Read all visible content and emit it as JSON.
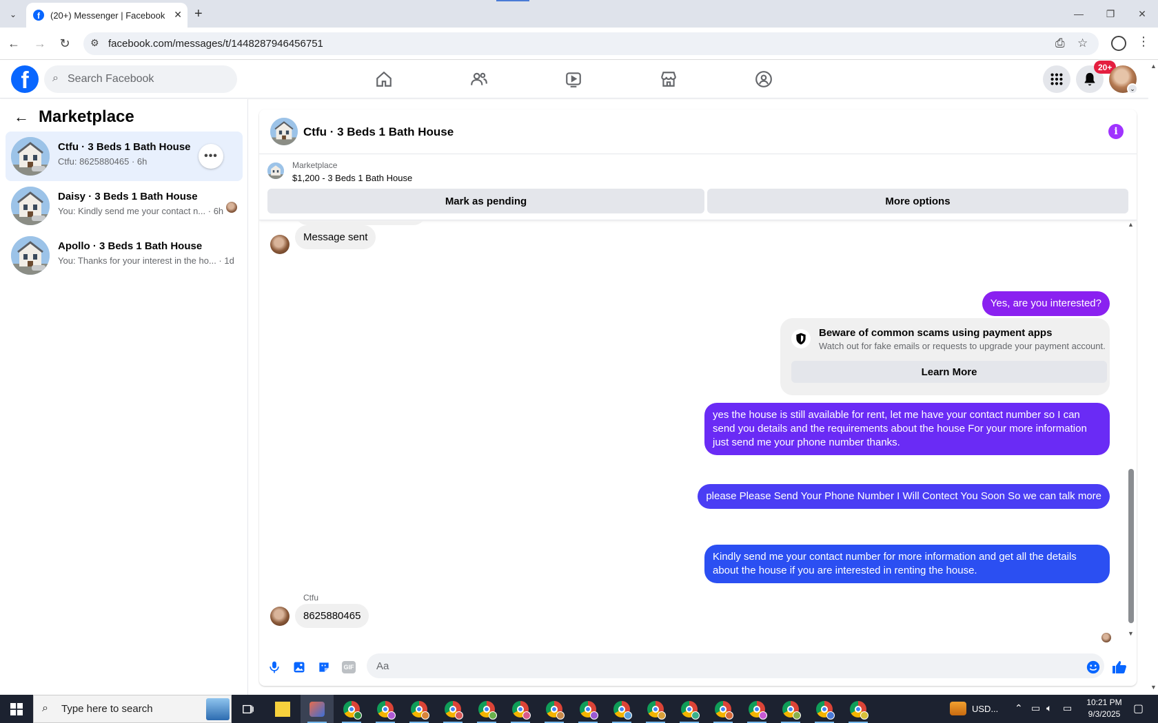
{
  "browser": {
    "tab_title": "(20+) Messenger | Facebook",
    "tab_close": "✕",
    "new_tab": "+",
    "url": "facebook.com/messages/t/1448287946456751"
  },
  "fb": {
    "logo_letter": "f",
    "search_placeholder": "Search Facebook",
    "notification_badge": "20+"
  },
  "left": {
    "title": "Marketplace",
    "conversations": [
      {
        "name": "Ctfu · 3 Beds 1 Bath House",
        "preview": "Ctfu: 8625880465 · 6h",
        "more": "•••"
      },
      {
        "name": "Daisy · 3 Beds 1 Bath House",
        "preview": "You: Kindly send me your contact n... · 6h"
      },
      {
        "name": "Apollo · 3 Beds 1 Bath House",
        "preview": "You: Thanks for your interest in the ho... · 1d"
      }
    ]
  },
  "chat": {
    "title": "Ctfu · 3 Beds 1 Bath House",
    "info_glyph": "i",
    "listing": {
      "label": "Marketplace",
      "price_title": "$1,200 - 3 Beds 1 Bath House",
      "mark_pending": "Mark as pending",
      "more_options": "More options"
    },
    "messages": {
      "incoming_1": "Message sent",
      "outgoing_1": "Yes, are you interested?",
      "scam_title": "Beware of common scams using payment apps",
      "scam_body": "Watch out for fake emails or requests to upgrade your payment account.",
      "learn_more": "Learn More",
      "outgoing_2": "yes the house is still available for rent, let me have your contact number so I can send you details and the requirements about the house For  your  more  information  just  send  me   your  phone  number thanks.",
      "outgoing_3": "please Please Send Your Phone Number I Will Contect You Soon So we can talk more",
      "outgoing_4": "Kindly send me your contact number for more information and get all the details about the house if you are interested in renting the house.",
      "sender": "Ctfu",
      "incoming_2": "8625880465"
    },
    "composer_placeholder": "Aa",
    "gif_label": "GIF"
  },
  "taskbar": {
    "search_placeholder": "Type here to search",
    "tray_currency": "USD...",
    "time": "10:21 PM",
    "date": "9/3/2025"
  },
  "colors": {
    "fb_blue": "#0866ff",
    "bubble_purple": "#8a21f0",
    "bubble_violet": "#6a2bf5",
    "bubble_indigo": "#4a3df4",
    "bubble_blue": "#2b4ff2",
    "info_purple": "#a033ff"
  }
}
